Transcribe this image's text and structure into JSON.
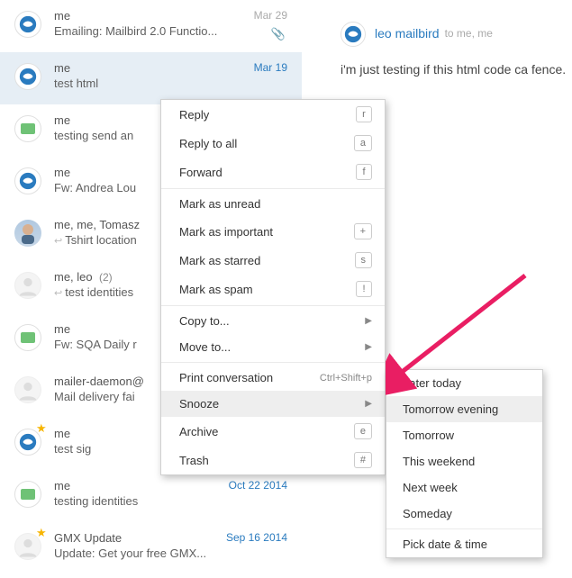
{
  "messages": [
    {
      "from": "me",
      "subject": "Emailing: Mailbird 2.0 Functio...",
      "date": "Mar 29",
      "attach": true,
      "avatar": "blue"
    },
    {
      "from": "me",
      "subject": "test html",
      "date": "Mar 19",
      "selected": true,
      "dateLink": true,
      "avatar": "blue"
    },
    {
      "from": "me",
      "subject": "testing send an",
      "avatar": "box"
    },
    {
      "from": "me",
      "subject": "Fw: Andrea Lou",
      "avatar": "blue"
    },
    {
      "from": "me, me, Tomasz",
      "subject": "Tshirt location",
      "reply": true,
      "avatar": "face"
    },
    {
      "from": "me, leo",
      "count": "(2)",
      "subject": "test identities",
      "reply": true,
      "avatar": "gray"
    },
    {
      "from": "me",
      "subject": "Fw: SQA Daily r",
      "avatar": "box"
    },
    {
      "from": "mailer-daemon@",
      "subject": "Mail delivery fai",
      "avatar": "gray"
    },
    {
      "from": "me",
      "subject": "test sig",
      "star": true,
      "avatar": "blue"
    },
    {
      "from": "me",
      "subject": "testing identities",
      "date": "Oct 22 2014",
      "dateLink": true,
      "avatar": "box"
    },
    {
      "from": "GMX Update",
      "subject": "Update: Get your free GMX...",
      "date": "Sep 16 2014",
      "dateLink": true,
      "star": true,
      "avatar": "gray"
    }
  ],
  "preview": {
    "sender": "leo mailbird",
    "recipients": "to me, me",
    "body": "i'm just testing if this html code ca fence."
  },
  "menu": {
    "reply": "Reply",
    "reply_key": "r",
    "replyall": "Reply to all",
    "replyall_key": "a",
    "forward": "Forward",
    "forward_key": "f",
    "unread": "Mark as unread",
    "important": "Mark as important",
    "important_key": "+",
    "starred": "Mark as starred",
    "starred_key": "s",
    "spam": "Mark as spam",
    "spam_key": "!",
    "copy": "Copy to...",
    "move": "Move to...",
    "print": "Print conversation",
    "print_key": "Ctrl+Shift+p",
    "snooze": "Snooze",
    "archive": "Archive",
    "archive_key": "e",
    "trash": "Trash",
    "trash_key": "#"
  },
  "submenu": {
    "later": "Later today",
    "tom_eve": "Tomorrow evening",
    "tom": "Tomorrow",
    "weekend": "This weekend",
    "next": "Next week",
    "someday": "Someday",
    "pick": "Pick date & time"
  }
}
